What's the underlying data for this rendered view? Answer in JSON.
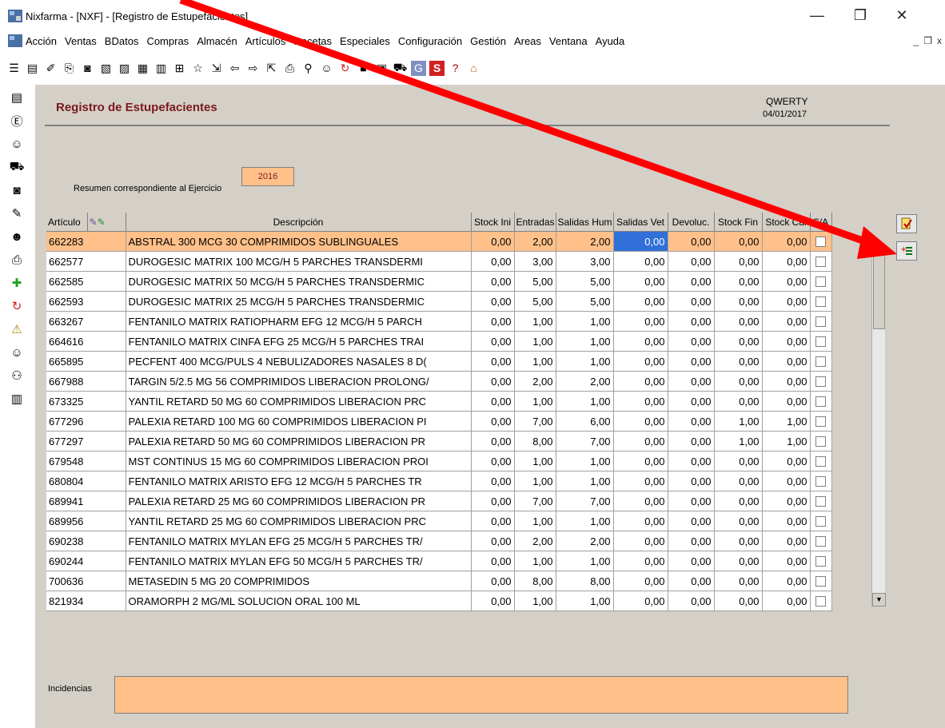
{
  "window": {
    "title": "Nixfarma - [NXF] - [Registro de Estupefacientes]",
    "minimize": "—",
    "restore": "❐",
    "close": "✕"
  },
  "menu": [
    "Acción",
    "Ventas",
    "BDatos",
    "Compras",
    "Almacén",
    "Artículos",
    "Recetas",
    "Especiales",
    "Configuración",
    "Gestión",
    "Areas",
    "Ventana",
    "Ayuda"
  ],
  "page": {
    "title": "Registro de Estupefacientes",
    "user": "QWERTY",
    "date": "04/01/2017",
    "resumen_label": "Resumen correspondiente al Ejercicio",
    "ejercicio": "2016",
    "incidencias_label": "Incidencias"
  },
  "table": {
    "headers": {
      "articulo": "Artículo",
      "descripcion": "Descripción",
      "stock_ini": "Stock Ini",
      "entradas": "Entradas",
      "salidas_hum": "Salidas Hum",
      "salidas_vet": "Salidas Vet",
      "devoluc": "Devoluc.",
      "stock_fin": "Stock Fin",
      "stock_cal": "Stock Cal",
      "sa": "S/A"
    },
    "rows": [
      {
        "art": "662283",
        "desc": "ABSTRAL 300 MCG 30 COMPRIMIDOS SUBLINGUALES",
        "ini": "0,00",
        "ent": "2,00",
        "sh": "2,00",
        "sv": "0,00",
        "dev": "0,00",
        "fin": "0,00",
        "cal": "0,00"
      },
      {
        "art": "662577",
        "desc": "DUROGESIC MATRIX 100 MCG/H 5 PARCHES TRANSDERMI",
        "ini": "0,00",
        "ent": "3,00",
        "sh": "3,00",
        "sv": "0,00",
        "dev": "0,00",
        "fin": "0,00",
        "cal": "0,00"
      },
      {
        "art": "662585",
        "desc": "DUROGESIC MATRIX 50 MCG/H 5 PARCHES TRANSDERMIC",
        "ini": "0,00",
        "ent": "5,00",
        "sh": "5,00",
        "sv": "0,00",
        "dev": "0,00",
        "fin": "0,00",
        "cal": "0,00"
      },
      {
        "art": "662593",
        "desc": "DUROGESIC MATRIX 25 MCG/H 5 PARCHES TRANSDERMIC",
        "ini": "0,00",
        "ent": "5,00",
        "sh": "5,00",
        "sv": "0,00",
        "dev": "0,00",
        "fin": "0,00",
        "cal": "0,00"
      },
      {
        "art": "663267",
        "desc": "FENTANILO MATRIX RATIOPHARM EFG 12 MCG/H 5 PARCH",
        "ini": "0,00",
        "ent": "1,00",
        "sh": "1,00",
        "sv": "0,00",
        "dev": "0,00",
        "fin": "0,00",
        "cal": "0,00"
      },
      {
        "art": "664616",
        "desc": "FENTANILO MATRIX CINFA EFG 25 MCG/H 5 PARCHES TRAI",
        "ini": "0,00",
        "ent": "1,00",
        "sh": "1,00",
        "sv": "0,00",
        "dev": "0,00",
        "fin": "0,00",
        "cal": "0,00"
      },
      {
        "art": "665895",
        "desc": "PECFENT 400 MCG/PULS 4 NEBULIZADORES NASALES 8 D(",
        "ini": "0,00",
        "ent": "1,00",
        "sh": "1,00",
        "sv": "0,00",
        "dev": "0,00",
        "fin": "0,00",
        "cal": "0,00"
      },
      {
        "art": "667988",
        "desc": "TARGIN 5/2.5 MG 56 COMPRIMIDOS LIBERACION PROLONG/",
        "ini": "0,00",
        "ent": "2,00",
        "sh": "2,00",
        "sv": "0,00",
        "dev": "0,00",
        "fin": "0,00",
        "cal": "0,00"
      },
      {
        "art": "673325",
        "desc": "YANTIL RETARD 50 MG 60 COMPRIMIDOS LIBERACION PRC",
        "ini": "0,00",
        "ent": "1,00",
        "sh": "1,00",
        "sv": "0,00",
        "dev": "0,00",
        "fin": "0,00",
        "cal": "0,00"
      },
      {
        "art": "677296",
        "desc": "PALEXIA RETARD 100 MG 60 COMPRIMIDOS LIBERACION PI",
        "ini": "0,00",
        "ent": "7,00",
        "sh": "6,00",
        "sv": "0,00",
        "dev": "0,00",
        "fin": "1,00",
        "cal": "1,00"
      },
      {
        "art": "677297",
        "desc": "PALEXIA RETARD 50 MG 60 COMPRIMIDOS LIBERACION PR",
        "ini": "0,00",
        "ent": "8,00",
        "sh": "7,00",
        "sv": "0,00",
        "dev": "0,00",
        "fin": "1,00",
        "cal": "1,00"
      },
      {
        "art": "679548",
        "desc": "MST CONTINUS 15 MG 60 COMPRIMIDOS LIBERACION PROI",
        "ini": "0,00",
        "ent": "1,00",
        "sh": "1,00",
        "sv": "0,00",
        "dev": "0,00",
        "fin": "0,00",
        "cal": "0,00"
      },
      {
        "art": "680804",
        "desc": "FENTANILO MATRIX ARISTO EFG 12 MCG/H 5 PARCHES TR",
        "ini": "0,00",
        "ent": "1,00",
        "sh": "1,00",
        "sv": "0,00",
        "dev": "0,00",
        "fin": "0,00",
        "cal": "0,00"
      },
      {
        "art": "689941",
        "desc": "PALEXIA RETARD 25 MG 60 COMPRIMIDOS LIBERACION PR",
        "ini": "0,00",
        "ent": "7,00",
        "sh": "7,00",
        "sv": "0,00",
        "dev": "0,00",
        "fin": "0,00",
        "cal": "0,00"
      },
      {
        "art": "689956",
        "desc": "YANTIL RETARD 25 MG 60 COMPRIMIDOS LIBERACION PRC",
        "ini": "0,00",
        "ent": "1,00",
        "sh": "1,00",
        "sv": "0,00",
        "dev": "0,00",
        "fin": "0,00",
        "cal": "0,00"
      },
      {
        "art": "690238",
        "desc": "FENTANILO MATRIX MYLAN EFG 25 MCG/H 5 PARCHES TR/",
        "ini": "0,00",
        "ent": "2,00",
        "sh": "2,00",
        "sv": "0,00",
        "dev": "0,00",
        "fin": "0,00",
        "cal": "0,00"
      },
      {
        "art": "690244",
        "desc": "FENTANILO MATRIX MYLAN EFG 50 MCG/H 5 PARCHES TR/",
        "ini": "0,00",
        "ent": "1,00",
        "sh": "1,00",
        "sv": "0,00",
        "dev": "0,00",
        "fin": "0,00",
        "cal": "0,00"
      },
      {
        "art": "700636",
        "desc": "METASEDIN 5 MG 20 COMPRIMIDOS",
        "ini": "0,00",
        "ent": "8,00",
        "sh": "8,00",
        "sv": "0,00",
        "dev": "0,00",
        "fin": "0,00",
        "cal": "0,00"
      },
      {
        "art": "821934",
        "desc": "ORAMORPH 2 MG/ML SOLUCION ORAL 100 ML",
        "ini": "0,00",
        "ent": "1,00",
        "sh": "1,00",
        "sv": "0,00",
        "dev": "0,00",
        "fin": "0,00",
        "cal": "0,00"
      }
    ]
  },
  "icons": {
    "toolbar": [
      "list-icon",
      "new-icon",
      "edit-icon",
      "copy-icon",
      "binoculars-icon",
      "print-preview-icon",
      "filter-icon",
      "table-icon",
      "columns-icon",
      "tree-icon",
      "star-icon",
      "import-icon",
      "back-icon",
      "forward-icon",
      "export-icon",
      "print-icon",
      "search-icon",
      "person-icon",
      "refresh-icon",
      "stop-icon",
      "report-icon",
      "cart-icon",
      "g-icon",
      "s-icon",
      "help-icon",
      "home-icon"
    ],
    "left": [
      "stack-icon",
      "e-icon",
      "user-icon",
      "cart-icon",
      "binoculars-icon",
      "pencil-icon",
      "people-icon",
      "printer-icon",
      "plus-icon",
      "refresh-icon",
      "warning-icon",
      "person-icon",
      "group-icon",
      "barcode-icon"
    ]
  },
  "colors": {
    "accent_title": "#7b1a1a",
    "highlight_row": "#ffc08a",
    "active_cell": "#3070d8",
    "annotation_arrow": "#ff0000"
  }
}
